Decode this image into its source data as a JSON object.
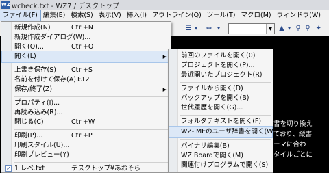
{
  "window": {
    "title": "wcheck.txt - WZ7 / デスクトップ",
    "icon_text": "WZ"
  },
  "menubar": [
    "ファイル(F)",
    "編集(E)",
    "検索(S)",
    "表示(V)",
    "挿入(I)",
    "アウトライン(Q)",
    "ツール(T)",
    "マクロ(M)",
    "ウィンドウ(W)"
  ],
  "file_menu": [
    {
      "label": "新規作成(N)",
      "shortcut": "Ctrl+N"
    },
    {
      "label": "新規作成ダイアログ(W)..."
    },
    {
      "label": "開く(O)...",
      "shortcut": "Ctrl+O"
    },
    {
      "label": "開く(L)",
      "has_submenu": true
    },
    {
      "label": "上書き保存(S)",
      "shortcut": "Ctrl+S"
    },
    {
      "label": "名前を付けて保存(A)...",
      "shortcut": "F12"
    },
    {
      "label": "保存/終了(Z)",
      "has_submenu": true
    },
    {
      "label": "プロパティ(I)..."
    },
    {
      "label": "再読み込み(R)..."
    },
    {
      "label": "閉じる(C)",
      "shortcut": "Ctrl+W"
    },
    {
      "label": "印刷(P)...",
      "shortcut": "Ctrl+P"
    },
    {
      "label": "印刷スタイル(U)..."
    },
    {
      "label": "印刷プレビュー(Y)"
    },
    {
      "label": "1 レベ.txt",
      "shortcut": "デスクトップ¥あおそら",
      "checked": true
    }
  ],
  "open_submenu": [
    {
      "label": "前回のファイルを開く(0)"
    },
    {
      "label": "プロジェクトを開く(P)..."
    },
    {
      "label": "最近開いたプロジェクト(R)"
    },
    {
      "label": "ファイルから開く(D)"
    },
    {
      "label": "バックアップを開く(B)"
    },
    {
      "label": "世代履歴を開く(G)..."
    },
    {
      "label": "フォルダテキストを開く(F)"
    },
    {
      "label": "WZ-IMEのユーザ辞書を開く(W)"
    },
    {
      "label": "バイナリ編集(B)"
    },
    {
      "label": "WZ Boardで開く(M)"
    },
    {
      "label": "関連付けプログラムで開く(S)"
    }
  ],
  "editor_text": [
    "一辞書を切り換え",
    "されており、縦書",
    "いテーマに合わ",
    "、スタイルごとに"
  ]
}
